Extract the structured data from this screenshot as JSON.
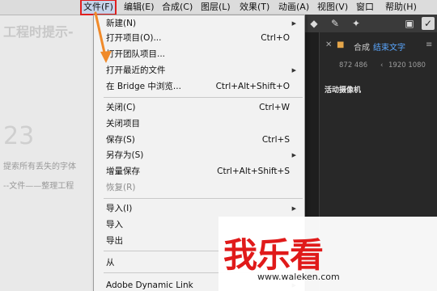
{
  "menubar": {
    "items": [
      "文件(F)",
      "编辑(E)",
      "合成(C)",
      "图层(L)",
      "效果(T)",
      "动画(A)",
      "视图(V)",
      "窗口",
      "帮助(H)"
    ]
  },
  "background_doc": {
    "heading": "工程时提示-",
    "number": "23",
    "text1": "提索所有丢失的字体",
    "text2": "--文件——整理工程"
  },
  "file_menu": {
    "items": [
      {
        "label": "新建(N)",
        "shortcut": "",
        "submenu": true,
        "disabled": false
      },
      {
        "label": "打开项目(O)...",
        "shortcut": "Ctrl+O",
        "submenu": false,
        "disabled": false
      },
      {
        "label": "打开团队项目...",
        "shortcut": "",
        "submenu": false,
        "disabled": false
      },
      {
        "label": "打开最近的文件",
        "shortcut": "",
        "submenu": true,
        "disabled": false
      },
      {
        "label": "在 Bridge 中浏览...",
        "shortcut": "Ctrl+Alt+Shift+O",
        "submenu": false,
        "disabled": false
      },
      {
        "label": "关闭(C)",
        "shortcut": "Ctrl+W",
        "submenu": false,
        "disabled": false
      },
      {
        "label": "关闭项目",
        "shortcut": "",
        "submenu": false,
        "disabled": false
      },
      {
        "label": "保存(S)",
        "shortcut": "Ctrl+S",
        "submenu": false,
        "disabled": false
      },
      {
        "label": "另存为(S)",
        "shortcut": "",
        "submenu": true,
        "disabled": false
      },
      {
        "label": "增量保存",
        "shortcut": "Ctrl+Alt+Shift+S",
        "submenu": false,
        "disabled": false
      },
      {
        "label": "恢复(R)",
        "shortcut": "",
        "submenu": false,
        "disabled": true
      },
      {
        "label": "导入(I)",
        "shortcut": "",
        "submenu": true,
        "disabled": false
      },
      {
        "label": "导入",
        "shortcut": "",
        "submenu": false,
        "disabled": false
      },
      {
        "label": "导出",
        "shortcut": "",
        "submenu": false,
        "disabled": false
      },
      {
        "label": "从 ",
        "shortcut": "",
        "submenu": false,
        "disabled": false
      },
      {
        "label": "Adobe Dynamic Link",
        "shortcut": "",
        "submenu": true,
        "disabled": false
      }
    ]
  },
  "right_panel": {
    "comp_tab_label": "合成",
    "comp_name": "结束文字",
    "info_left": "872 486",
    "info_right": "1920 1080",
    "camera_label": "活动摄像机"
  },
  "watermark": {
    "logo_text": "我乐看",
    "url": "www.waleken.com"
  },
  "colors": {
    "menubar_bg": "#dcdcdc",
    "highlight_box": "#e02020",
    "arrow": "#f08a2a",
    "comp_name": "#5aa7ff",
    "logo_red": "#e01a1a"
  }
}
